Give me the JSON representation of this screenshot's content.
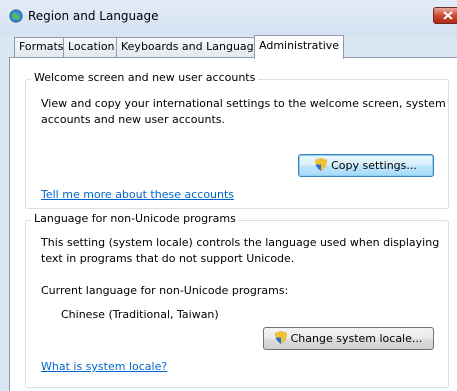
{
  "window": {
    "title": "Region and Language",
    "icon": "globe-icon",
    "close_icon": "close-icon"
  },
  "tabs": [
    {
      "label": "Formats",
      "active": false
    },
    {
      "label": "Location",
      "active": false
    },
    {
      "label": "Keyboards and Languages",
      "active": false
    },
    {
      "label": "Administrative",
      "active": true
    }
  ],
  "welcome": {
    "legend": "Welcome screen and new user accounts",
    "description_line1": "View and copy your international settings to the welcome screen, system",
    "description_line2": "accounts and new user accounts.",
    "copy_button": "Copy settings...",
    "link": "Tell me more about these accounts"
  },
  "non_unicode": {
    "legend": "Language for non-Unicode programs",
    "description_line1": "This setting (system locale) controls the language used when displaying",
    "description_line2": "text in programs that do not support Unicode.",
    "current_label": "Current language for non-Unicode programs:",
    "current_value": "Chinese (Traditional, Taiwan)",
    "change_button": "Change system locale...",
    "link": "What is system locale?"
  },
  "colors": {
    "link": "#0066cc",
    "window_frame": "#dbe6f3",
    "close_button": "#c8432c"
  }
}
